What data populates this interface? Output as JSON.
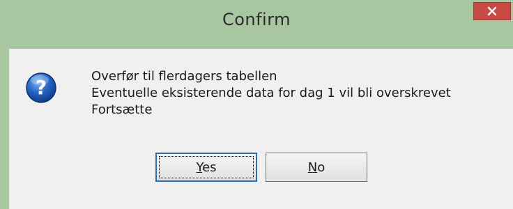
{
  "window": {
    "title": "Confirm",
    "close_icon": "close-icon",
    "accent_close": "#c94a44"
  },
  "dialog": {
    "icon": "question-icon",
    "message_lines": [
      "Overfør til flerdagers tabellen",
      "Eventuelle eksisterende data for dag 1 vil bli overskrevet",
      "Fortsætte"
    ]
  },
  "buttons": {
    "yes": {
      "accel": "Y",
      "rest": "es"
    },
    "no": {
      "accel": "N",
      "rest": "o"
    }
  }
}
